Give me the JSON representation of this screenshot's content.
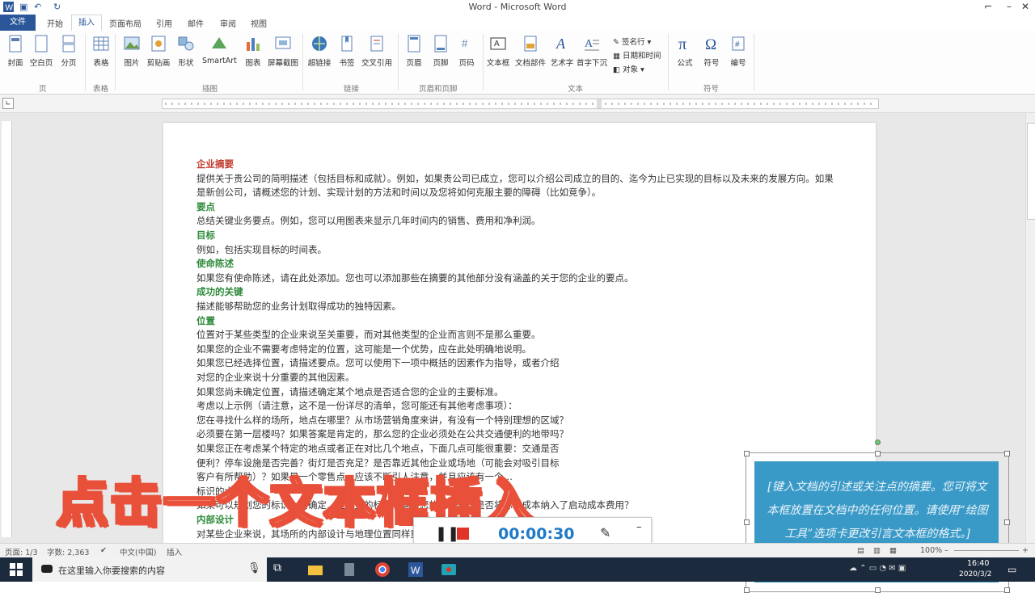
{
  "window": {
    "title": "Word - Microsoft Word"
  },
  "tabs": [
    {
      "label": "文件"
    },
    {
      "label": "开始"
    },
    {
      "label": "插入"
    },
    {
      "label": "页面布局"
    },
    {
      "label": "引用"
    },
    {
      "label": "邮件"
    },
    {
      "label": "审阅"
    },
    {
      "label": "视图"
    }
  ],
  "ribbon": {
    "buttons": {
      "cover": "封面",
      "blank": "空白页",
      "pagebreak": "分页",
      "table": "表格",
      "picture": "图片",
      "clipart": "剪贴画",
      "shapes": "形状",
      "smartart": "SmartArt",
      "chart": "图表",
      "screenshot": "屏幕截图",
      "hyperlink": "超链接",
      "bookmark": "书签",
      "crossref": "交叉引用",
      "header": "页眉",
      "footer": "页脚",
      "pagenumber": "页码",
      "textbox": "文本框",
      "docparts": "文档部件",
      "wordart": "艺术字",
      "dropcap": "首字下沉",
      "signature": "签名行",
      "datetime": "日期和时间",
      "object": "对象",
      "equation": "公式",
      "symbol": "符号",
      "number": "编号"
    },
    "groups": {
      "pages": "页",
      "tables": "表格",
      "illustrations": "插图",
      "links": "链接",
      "headerfooter": "页眉和页脚",
      "text": "文本",
      "symbols": "符号"
    }
  },
  "document": {
    "lines": [
      {
        "text": "企业摘要",
        "style": "red"
      },
      {
        "text": "提供关于贵公司的简明描述（包括目标和成就）。例如，如果贵公司已成立，您可以介绍公司成立的目的、迄今为止已实现的目标以及未来的发展方向。如果",
        "style": "body"
      },
      {
        "text": "是新创公司，请概述您的计划、实现计划的方法和时间以及您将如何克服主要的障碍（比如竞争）。",
        "style": "body"
      },
      {
        "text": "要点",
        "style": "green"
      },
      {
        "text": "总结关键业务要点。例如，您可以用图表来显示几年时间内的销售、费用和净利润。",
        "style": "body"
      },
      {
        "text": "目标",
        "style": "green"
      },
      {
        "text": "例如，包括实现目标的时间表。",
        "style": "body"
      },
      {
        "text": "使命陈述",
        "style": "green"
      },
      {
        "text": "如果您有使命陈述，请在此处添加。您也可以添加那些在摘要的其他部分没有涵盖的关于您的企业的要点。",
        "style": "body"
      },
      {
        "text": "成功的关键",
        "style": "green"
      },
      {
        "text": "描述能够帮助您的业务计划取得成功的独特因素。",
        "style": "body"
      },
      {
        "text": "位置",
        "style": "green"
      },
      {
        "text": "位置对于某些类型的企业来说至关重要，而对其他类型的企业而言则不是那么重要。",
        "style": "body"
      },
      {
        "text": "如果您的企业不需要考虑特定的位置，这可能是一个优势，应在此处明确地说明。",
        "style": "body"
      },
      {
        "text": "如果您已经选择位置，请描述要点。您可以使用下一项中概括的因素作为指导，或者介绍",
        "style": "body"
      },
      {
        "text": "对您的企业来说十分重要的其他因素。",
        "style": "body"
      },
      {
        "text": "如果您尚未确定位置，请描述确定某个地点是否适合您的企业的主要标准。",
        "style": "body"
      },
      {
        "text": "考虑以上示例（请注意，这不是一份详尽的清单，您可能还有其他考虑事项）：",
        "style": "body"
      },
      {
        "text": "您在寻找什么样的场所，地点在哪里？从市场营销角度来讲，有没有一个特别理想的区域？",
        "style": "body"
      },
      {
        "text": "必须要在第一层楼吗？如果答案是肯定的，那么您的企业必须处在公共交通便利的地带吗？",
        "style": "body"
      },
      {
        "text": "如果您正在考虑某个特定的地点或者正在对比几个地点，下面几点可能很重要：交通是否",
        "style": "body"
      },
      {
        "text": "便利？停车设施是否完善？街灯是否充足？是否靠近其他企业或场地（可能会对吸引目标",
        "style": "body"
      },
      {
        "text": "客户有所帮助）？如果是一个零售点，应该不断引人注意，并且应该有一个…",
        "style": "body"
      },
      {
        "text": "标识的大小…",
        "style": "body"
      },
      {
        "text": "如果可以规划您的标识，请确定…这类型的标识能满足您的要求？您是否将标识成本纳入了启动成本费用？",
        "style": "body"
      },
      {
        "text": "内部设计",
        "style": "green"
      },
      {
        "text": "对某些企业来说，其场所的内部设计与地理位置同样重要…顺利运转。",
        "style": "body"
      }
    ],
    "textbox": "[键入文档的引述或关注点的摘要。您可将文本框放置在文档中的任何位置。请使用“绘图工具”选项卡更改引言文本框的格式。]"
  },
  "overlay": {
    "caption": "点击一个文本框插入"
  },
  "recorder": {
    "time": "00:00:30"
  },
  "status": {
    "page": "页面: 1/3",
    "words": "字数: 2,363",
    "lang": "中文(中国)",
    "mode": "插入",
    "zoom": "100%"
  },
  "taskbar": {
    "search_placeholder": "在这里输入你要搜索的内容",
    "time": "16:40",
    "date": "2020/3/2"
  },
  "colors": {
    "word_blue": "#2b579a",
    "textbox_fill": "#3a9ac7",
    "caption_stroke": "#e8503a",
    "heading_green": "#2e8b3a",
    "heading_red": "#c0392b"
  }
}
